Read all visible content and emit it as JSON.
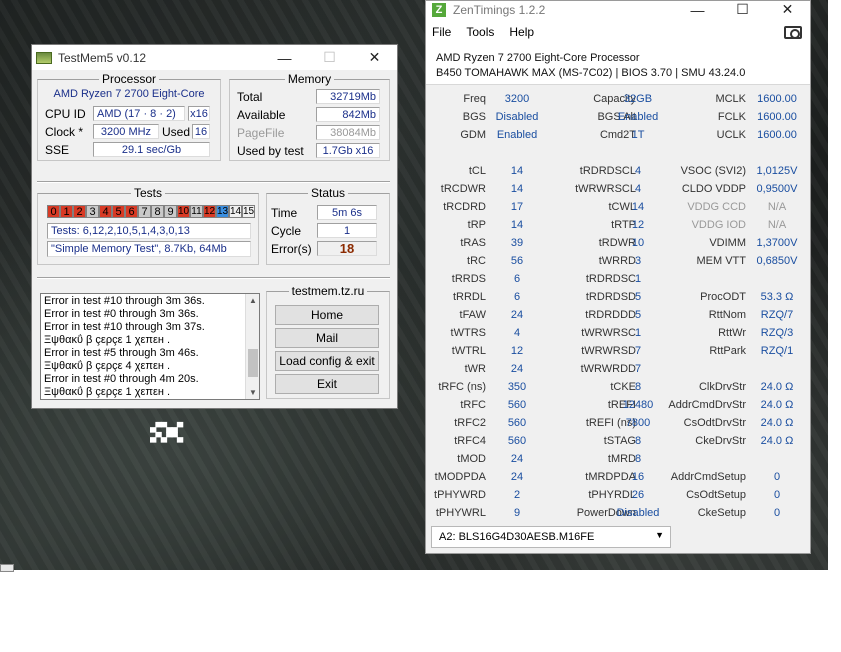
{
  "testmem": {
    "title": "TestMem5 v0.12",
    "processor": {
      "legend": "Processor",
      "name": "AMD Ryzen 7 2700 Eight-Core",
      "cpu_id_label": "CPU ID",
      "cpu_id": "AMD  (17 · 8 · 2)",
      "cpu_id_x": "x16",
      "clock_label": "Clock *",
      "clock": "3200 MHz",
      "used_label": "Used",
      "used": "16",
      "sse_label": "SSE",
      "sse": "29.1 sec/Gb"
    },
    "memory": {
      "legend": "Memory",
      "total_label": "Total",
      "total": "32719Mb",
      "available_label": "Available",
      "available": "842Mb",
      "pagefile_label": "PageFile",
      "pagefile": "38084Mb",
      "usedtest_label": "Used by test",
      "usedtest": "1.7Gb x16"
    },
    "tests": {
      "legend": "Tests",
      "cells": [
        {
          "n": "0",
          "s": "red"
        },
        {
          "n": "1",
          "s": "red"
        },
        {
          "n": "2",
          "s": "red"
        },
        {
          "n": "3",
          "s": "gry"
        },
        {
          "n": "4",
          "s": "red"
        },
        {
          "n": "5",
          "s": "red"
        },
        {
          "n": "6",
          "s": "red"
        },
        {
          "n": "7",
          "s": "gry"
        },
        {
          "n": "8",
          "s": "gry"
        },
        {
          "n": "9",
          "s": "gry"
        },
        {
          "n": "10",
          "s": "red"
        },
        {
          "n": "11",
          "s": "gry"
        },
        {
          "n": "12",
          "s": "red"
        },
        {
          "n": "13",
          "s": "blu"
        },
        {
          "n": "14",
          "s": "wht"
        },
        {
          "n": "15",
          "s": "wht"
        }
      ],
      "sequence": "Tests: 6,12,2,10,5,1,4,3,0,13",
      "current": "\"Simple Memory Test\", 8.7Kb, 64Mb"
    },
    "status": {
      "legend": "Status",
      "time_label": "Time",
      "time": "5m 6s",
      "cycle_label": "Cycle",
      "cycle": "1",
      "errors_label": "Error(s)",
      "errors": "18"
    },
    "log": [
      "Error in test #10 through 3m 36s.",
      "Error in test #0 through 3m 36s.",
      "Error in test #10 through 3m 37s.",
      "Ξψθακΰ β çερçε 1 χεπεн .",
      "Error in test #5 through 3m 46s.",
      "Ξψθακΰ β çερçε 4 χεπεн .",
      "Error in test #0 through 4m 20s.",
      "Ξψθακΰ β çερçε 1 χεπεн ."
    ],
    "site": "testmem.tz.ru",
    "buttons": {
      "home": "Home",
      "mail": "Mail",
      "load": "Load config & exit",
      "exit": "Exit"
    }
  },
  "zen": {
    "title": "ZenTimings 1.2.2",
    "menu": {
      "file": "File",
      "tools": "Tools",
      "help": "Help"
    },
    "cpu": "AMD Ryzen 7 2700 Eight-Core Processor",
    "board": "B450 TOMAHAWK MAX (MS-7C02) | BIOS 3.70 | SMU 43.24.0",
    "rows": [
      [
        "Freq",
        "3200",
        "Capacity",
        "32GB",
        "MCLK",
        "1600.00"
      ],
      [
        "BGS",
        "Disabled",
        "BGS Alt",
        "Enabled",
        "FCLK",
        "1600.00"
      ],
      [
        "GDM",
        "Enabled",
        "Cmd2T",
        "1T",
        "UCLK",
        "1600.00"
      ],
      [
        "",
        "",
        "",
        "",
        "",
        ""
      ],
      [
        "tCL",
        "14",
        "tRDRDSCL",
        "4",
        "VSOC (SVI2)",
        "1,0125V"
      ],
      [
        "tRCDWR",
        "14",
        "tWRWRSCL",
        "4",
        "CLDO VDDP",
        "0,9500V"
      ],
      [
        "tRCDRD",
        "17",
        "tCWL",
        "14",
        "VDDG CCD",
        "N/A"
      ],
      [
        "tRP",
        "14",
        "tRTP",
        "12",
        "VDDG IOD",
        "N/A"
      ],
      [
        "tRAS",
        "39",
        "tRDWR",
        "10",
        "VDIMM",
        "1,3700V"
      ],
      [
        "tRC",
        "56",
        "tWRRD",
        "3",
        "MEM VTT",
        "0,6850V"
      ],
      [
        "tRRDS",
        "6",
        "tRDRDSC",
        "1",
        "",
        ""
      ],
      [
        "tRRDL",
        "6",
        "tRDRDSD",
        "5",
        "ProcODT",
        "53.3 Ω"
      ],
      [
        "tFAW",
        "24",
        "tRDRDDD",
        "5",
        "RttNom",
        "RZQ/7"
      ],
      [
        "tWTRS",
        "4",
        "tWRWRSC",
        "1",
        "RttWr",
        "RZQ/3"
      ],
      [
        "tWTRL",
        "12",
        "tWRWRSD",
        "7",
        "RttPark",
        "RZQ/1"
      ],
      [
        "tWR",
        "24",
        "tWRWRDD",
        "7",
        "",
        ""
      ],
      [
        "tRFC (ns)",
        "350",
        "tCKE",
        "8",
        "ClkDrvStr",
        "24.0 Ω"
      ],
      [
        "tRFC",
        "560",
        "tREFI",
        "12480",
        "AddrCmdDrvStr",
        "24.0 Ω"
      ],
      [
        "tRFC2",
        "560",
        "tREFI (ns)",
        "7800",
        "CsOdtDrvStr",
        "24.0 Ω"
      ],
      [
        "tRFC4",
        "560",
        "tSTAG",
        "8",
        "CkeDrvStr",
        "24.0 Ω"
      ],
      [
        "tMOD",
        "24",
        "tMRD",
        "8",
        "",
        ""
      ],
      [
        "tMODPDA",
        "24",
        "tMRDPDA",
        "16",
        "AddrCmdSetup",
        "0"
      ],
      [
        "tPHYWRD",
        "2",
        "tPHYRDL",
        "26",
        "CsOdtSetup",
        "0"
      ],
      [
        "tPHYWRL",
        "9",
        "PowerDown",
        "Disabled",
        "CkeSetup",
        "0"
      ]
    ],
    "dimm": "A2: BLS16G4D30AESB.M16FE"
  },
  "desktop_glyph": "▄▀▀▄▄▀ ▄▀▄▀▀▄"
}
